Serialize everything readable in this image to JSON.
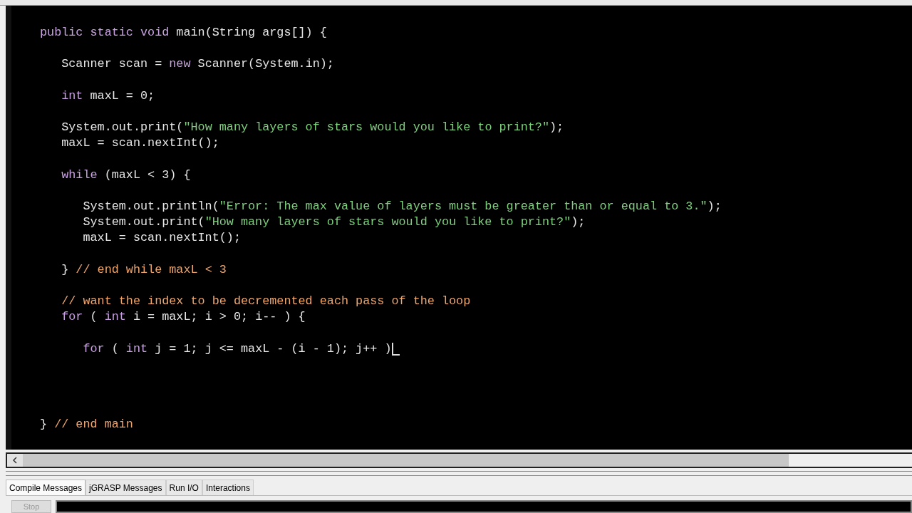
{
  "editor": {
    "blocks": [
      {
        "lines": [
          {
            "tokens": [
              {
                "kind": "keyword",
                "text": "public static void "
              },
              {
                "kind": "plain",
                "text": "main(String args[]) {"
              }
            ]
          }
        ]
      },
      {
        "lines": [
          {
            "tokens": [
              {
                "kind": "plain",
                "text": "   Scanner scan = "
              },
              {
                "kind": "keyword",
                "text": "new"
              },
              {
                "kind": "plain",
                "text": " Scanner(System.in);"
              }
            ]
          }
        ]
      },
      {
        "lines": [
          {
            "tokens": [
              {
                "kind": "keyword",
                "text": "   int"
              },
              {
                "kind": "plain",
                "text": " maxL = 0;"
              }
            ]
          }
        ]
      },
      {
        "lines": [
          {
            "tokens": [
              {
                "kind": "plain",
                "text": "   System.out.print("
              },
              {
                "kind": "string",
                "text": "\"How many layers of stars would you like to print?\""
              },
              {
                "kind": "plain",
                "text": ");"
              }
            ]
          },
          {
            "tokens": [
              {
                "kind": "plain",
                "text": "   maxL = scan.nextInt();"
              }
            ]
          }
        ]
      },
      {
        "lines": [
          {
            "tokens": [
              {
                "kind": "keyword",
                "text": "   while"
              },
              {
                "kind": "plain",
                "text": " (maxL < 3) {"
              }
            ]
          }
        ]
      },
      {
        "lines": [
          {
            "tokens": [
              {
                "kind": "plain",
                "text": "      System.out.println("
              },
              {
                "kind": "string",
                "text": "\"Error: The max value of layers must be greater than or equal to 3.\""
              },
              {
                "kind": "plain",
                "text": ");"
              }
            ]
          },
          {
            "tokens": [
              {
                "kind": "plain",
                "text": "      System.out.print("
              },
              {
                "kind": "string",
                "text": "\"How many layers of stars would you like to print?\""
              },
              {
                "kind": "plain",
                "text": ");"
              }
            ]
          },
          {
            "tokens": [
              {
                "kind": "plain",
                "text": "      maxL = scan.nextInt();"
              }
            ]
          }
        ]
      },
      {
        "lines": [
          {
            "tokens": [
              {
                "kind": "plain",
                "text": "   } "
              },
              {
                "kind": "comment",
                "text": "// end while maxL < 3"
              }
            ]
          }
        ]
      },
      {
        "lines": [
          {
            "tokens": [
              {
                "kind": "comment",
                "text": "   // want the index to be decremented each pass of the loop"
              }
            ]
          },
          {
            "tokens": [
              {
                "kind": "keyword",
                "text": "   for"
              },
              {
                "kind": "plain",
                "text": " ( "
              },
              {
                "kind": "keyword",
                "text": "int"
              },
              {
                "kind": "plain",
                "text": " i = maxL; i > 0; i-- ) {"
              }
            ]
          }
        ]
      },
      {
        "lines": [
          {
            "tokens": [
              {
                "kind": "keyword",
                "text": "      for"
              },
              {
                "kind": "plain",
                "text": " ( "
              },
              {
                "kind": "keyword",
                "text": "int"
              },
              {
                "kind": "plain",
                "text": " j = 1; j <= maxL - (i - 1); j++ )"
              }
            ],
            "cursor": true
          }
        ]
      }
    ],
    "closing": {
      "tokens": [
        {
          "kind": "plain",
          "text": "} "
        },
        {
          "kind": "comment",
          "text": "// end main"
        }
      ]
    }
  },
  "tabs": [
    {
      "label": "Compile Messages",
      "selected": true
    },
    {
      "label": "jGRASP Messages",
      "selected": false
    },
    {
      "label": "Run I/O",
      "selected": false
    },
    {
      "label": "Interactions",
      "selected": false
    }
  ],
  "stop_button": {
    "label": "Stop",
    "disabled": true
  }
}
